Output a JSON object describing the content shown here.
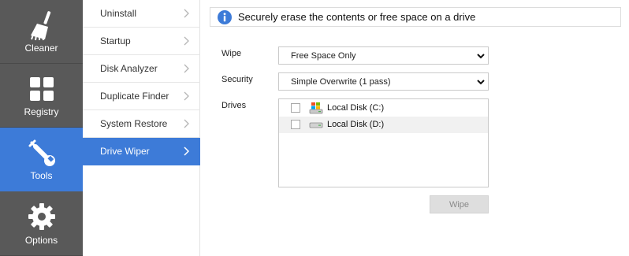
{
  "nav": {
    "items": [
      {
        "label": "Cleaner",
        "icon": "broom-icon",
        "active": false
      },
      {
        "label": "Registry",
        "icon": "grid-icon",
        "active": false
      },
      {
        "label": "Tools",
        "icon": "wrench-icon",
        "active": true
      },
      {
        "label": "Options",
        "icon": "gear-icon",
        "active": false
      }
    ]
  },
  "submenu": {
    "items": [
      {
        "label": "Uninstall"
      },
      {
        "label": "Startup"
      },
      {
        "label": "Disk Analyzer"
      },
      {
        "label": "Duplicate Finder"
      },
      {
        "label": "System Restore"
      },
      {
        "label": "Drive Wiper",
        "active": true
      }
    ]
  },
  "info": {
    "text": "Securely erase the contents or free space on a drive",
    "icon": "info-icon"
  },
  "form": {
    "wipe_label": "Wipe",
    "wipe_value": "Free Space Only",
    "security_label": "Security",
    "security_value": "Simple Overwrite (1 pass)",
    "drives_label": "Drives",
    "drives": [
      {
        "label": "Local Disk (C:)",
        "icon": "windows-drive-icon",
        "checked": false
      },
      {
        "label": "Local Disk (D:)",
        "icon": "hard-drive-icon",
        "checked": false
      }
    ],
    "wipe_button": "Wipe"
  },
  "colors": {
    "sidebar": "#595959",
    "accent": "#3d7bd8"
  }
}
